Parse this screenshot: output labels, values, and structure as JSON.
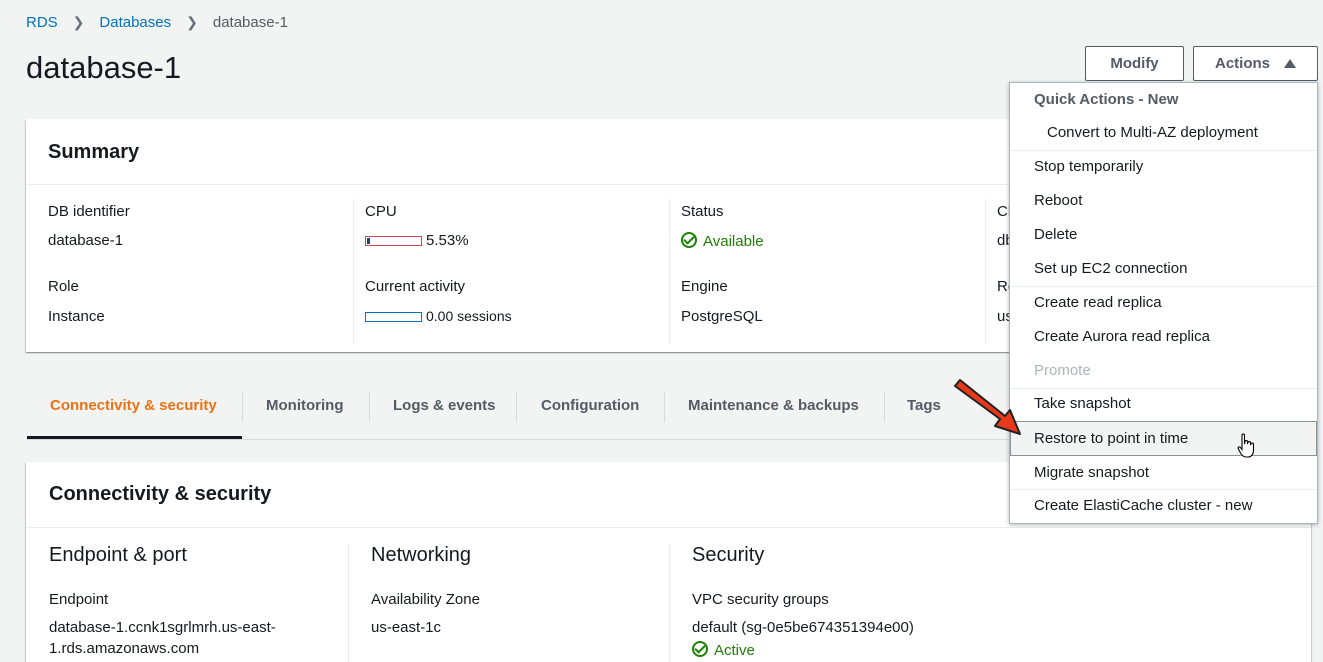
{
  "breadcrumb": {
    "root": "RDS",
    "parent": "Databases",
    "current": "database-1"
  },
  "page_title": "database-1",
  "buttons": {
    "modify": "Modify",
    "actions": "Actions"
  },
  "summary": {
    "title": "Summary",
    "db_identifier_label": "DB identifier",
    "db_identifier_value": "database-1",
    "role_label": "Role",
    "role_value": "Instance",
    "cpu_label": "CPU",
    "cpu_value": "5.53%",
    "cpu_fraction": 0.0553,
    "activity_label": "Current activity",
    "activity_value": "0.00 sessions",
    "status_label": "Status",
    "status_value": "Available",
    "engine_label": "Engine",
    "engine_value": "PostgreSQL",
    "col4_label1": "Cl",
    "col4_value1": "db",
    "col4_label2": "Re",
    "col4_value2": "us"
  },
  "tabs": [
    {
      "label": "Connectivity & security",
      "active": true
    },
    {
      "label": "Monitoring"
    },
    {
      "label": "Logs & events"
    },
    {
      "label": "Configuration"
    },
    {
      "label": "Maintenance & backups"
    },
    {
      "label": "Tags"
    }
  ],
  "connectivity": {
    "title": "Connectivity & security",
    "endpoint_port_title": "Endpoint & port",
    "endpoint_label": "Endpoint",
    "endpoint_line1": "database-1.ccnk1sgrlmrh.us-east-",
    "endpoint_line2": "1.rds.amazonaws.com",
    "networking_title": "Networking",
    "az_label": "Availability Zone",
    "az_value": "us-east-1c",
    "security_title": "Security",
    "vpc_sg_label": "VPC security groups",
    "vpc_sg_value": "default (sg-0e5be674351394e00)",
    "vpc_sg_status": "Active"
  },
  "actions_menu": {
    "quick_actions_header": "Quick Actions - New",
    "convert_multi_az": "Convert to Multi-AZ deployment",
    "stop_temporarily": "Stop temporarily",
    "reboot": "Reboot",
    "delete": "Delete",
    "setup_ec2": "Set up EC2 connection",
    "create_read_replica": "Create read replica",
    "create_aurora_replica": "Create Aurora read replica",
    "promote": "Promote",
    "take_snapshot": "Take snapshot",
    "restore_pitr": "Restore to point in time",
    "migrate_snapshot": "Migrate snapshot",
    "create_elasticache": "Create ElastiCache cluster - new"
  },
  "colors": {
    "accent_orange": "#ec7211",
    "link_blue": "#0073bb",
    "success_green": "#1d8102",
    "annotation_red": "#e8381b"
  },
  "icons": {
    "breadcrumb_separator": "chevron-right-icon",
    "status": "check-circle-icon",
    "actions_caret": "caret-up-icon",
    "annotation": "red-arrow-icon",
    "pointer": "hand-cursor-icon"
  }
}
